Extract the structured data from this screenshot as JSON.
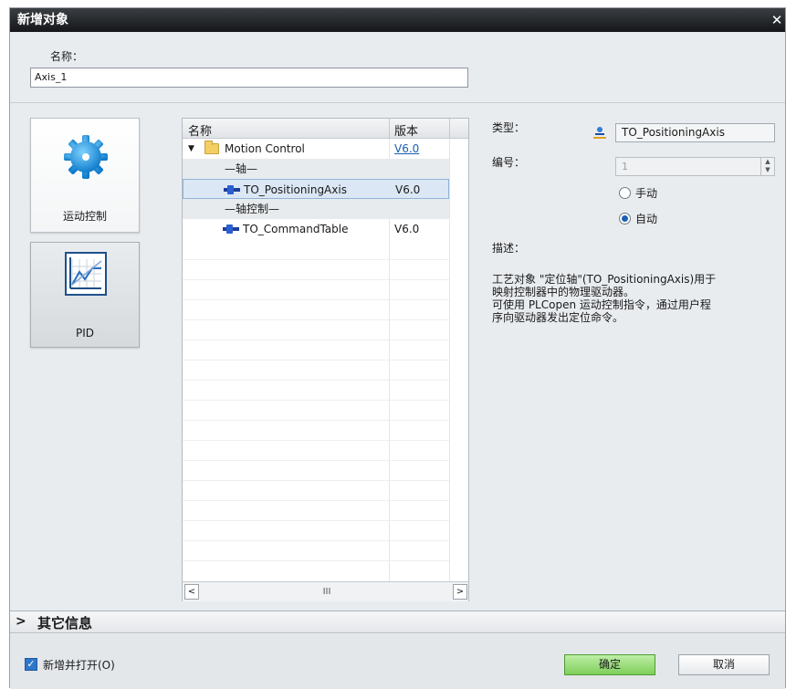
{
  "dialog": {
    "title": "新增对象"
  },
  "name": {
    "label": "名称：",
    "value": "Axis_1"
  },
  "categories": [
    {
      "label": "运动控制",
      "icon": "gear-icon",
      "selected": false
    },
    {
      "label": "PID",
      "icon": "pid-chart-icon",
      "selected": true
    }
  ],
  "tree": {
    "headers": {
      "name": "名称",
      "version": "版本"
    },
    "rows": [
      {
        "label": "Motion Control",
        "version": "V6.0",
        "kind": "folder"
      },
      {
        "label": "—轴—",
        "version": "",
        "kind": "group"
      },
      {
        "label": "TO_PositioningAxis",
        "version": "V6.0",
        "kind": "object",
        "selected": true
      },
      {
        "label": "—轴控制—",
        "version": "",
        "kind": "group"
      },
      {
        "label": "TO_CommandTable",
        "version": "V6.0",
        "kind": "object"
      }
    ],
    "scroll_thumb": "III"
  },
  "props": {
    "type_label": "类型：",
    "type_value": "TO_PositioningAxis",
    "number_label": "编号：",
    "number_value": "1",
    "manual_label": "手动",
    "auto_label": "自动",
    "mode_selected": "auto",
    "desc_label": "描述：",
    "desc_lines": [
      "工艺对象 \"定位轴\"(TO_PositioningAxis)用于",
      "映射控制器中的物理驱动器。",
      "可使用 PLCopen 运动控制指令，通过用户程",
      "序向驱动器发出定位命令。"
    ]
  },
  "more_info": {
    "label": "其它信息"
  },
  "footer": {
    "checkbox_label": "新增并打开(O)",
    "checked": true,
    "ok_label": "确定",
    "cancel_label": "取消"
  },
  "colors": {
    "titlebar": "#1e2124",
    "ok_button": "#8fd66a",
    "accent": "#1a5fb4"
  }
}
